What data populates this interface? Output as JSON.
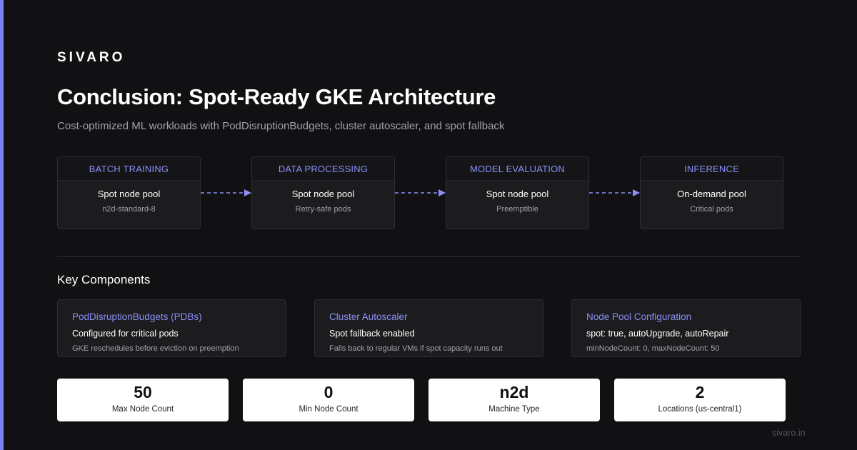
{
  "brand": "SIVARO",
  "title": "Conclusion: Spot-Ready GKE Architecture",
  "subtitle": "Cost-optimized ML workloads with PodDisruptionBudgets, cluster autoscaler, and spot fallback",
  "pipeline": [
    {
      "header": "BATCH TRAINING",
      "main": "Spot node pool",
      "sub": "n2d-standard-8"
    },
    {
      "header": "DATA PROCESSING",
      "main": "Spot node pool",
      "sub": "Retry-safe pods"
    },
    {
      "header": "MODEL EVALUATION",
      "main": "Spot node pool",
      "sub": "Preemptible"
    },
    {
      "header": "INFERENCE",
      "main": "On-demand pool",
      "sub": "Critical pods"
    }
  ],
  "key_components": {
    "title": "Key Components",
    "items": [
      {
        "title": "PodDisruptionBudgets (PDBs)",
        "main": "Configured for critical pods",
        "sub": "GKE reschedules before eviction on preemption"
      },
      {
        "title": "Cluster Autoscaler",
        "main": "Spot fallback enabled",
        "sub": "Falls back to regular VMs if spot capacity runs out"
      },
      {
        "title": "Node Pool Configuration",
        "main": "spot: true, autoUpgrade, autoRepair",
        "sub": "minNodeCount: 0, maxNodeCount: 50"
      }
    ]
  },
  "stats": [
    {
      "value": "50",
      "label": "Max Node Count"
    },
    {
      "value": "0",
      "label": "Min Node Count"
    },
    {
      "value": "n2d",
      "label": "Machine Type"
    },
    {
      "value": "2",
      "label": "Locations (us-central1)"
    }
  ],
  "footer": "sivaro.in",
  "colors": {
    "accent": "#7b7ff0",
    "background": "#111113",
    "card": "#1c1c1f",
    "muted_text": "#a1a1aa"
  }
}
